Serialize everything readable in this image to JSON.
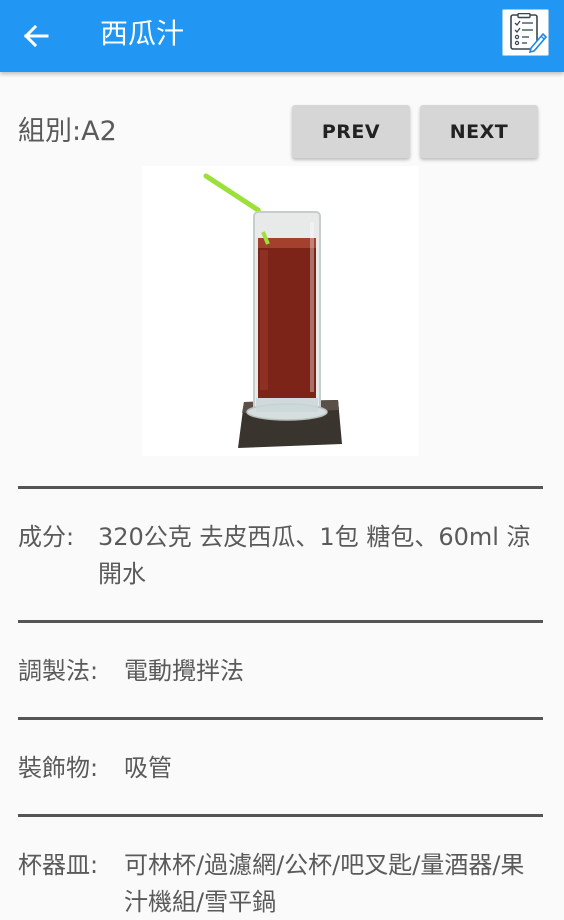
{
  "appbar": {
    "title": "西瓜汁",
    "background": "#2196f3",
    "back_icon": "arrow-left-icon",
    "action_icon": "checklist-edit-icon"
  },
  "group": {
    "label": "組別:",
    "value": "A2"
  },
  "nav": {
    "prev_label": "PREV",
    "next_label": "NEXT"
  },
  "image": {
    "subject": "watermelon-juice-glass-with-straw"
  },
  "details": {
    "ingredients": {
      "label": "成分:",
      "value": "320公克 去皮西瓜、1包 糖包、60ml 涼開水"
    },
    "method": {
      "label": "調製法:",
      "value": "電動攪拌法"
    },
    "garnish": {
      "label": "裝飾物:",
      "value": "吸管"
    },
    "glassware": {
      "label": "杯器皿:",
      "value": "可林杯/過濾網/公杯/吧叉匙/量酒器/果汁機組/雪平鍋"
    }
  }
}
